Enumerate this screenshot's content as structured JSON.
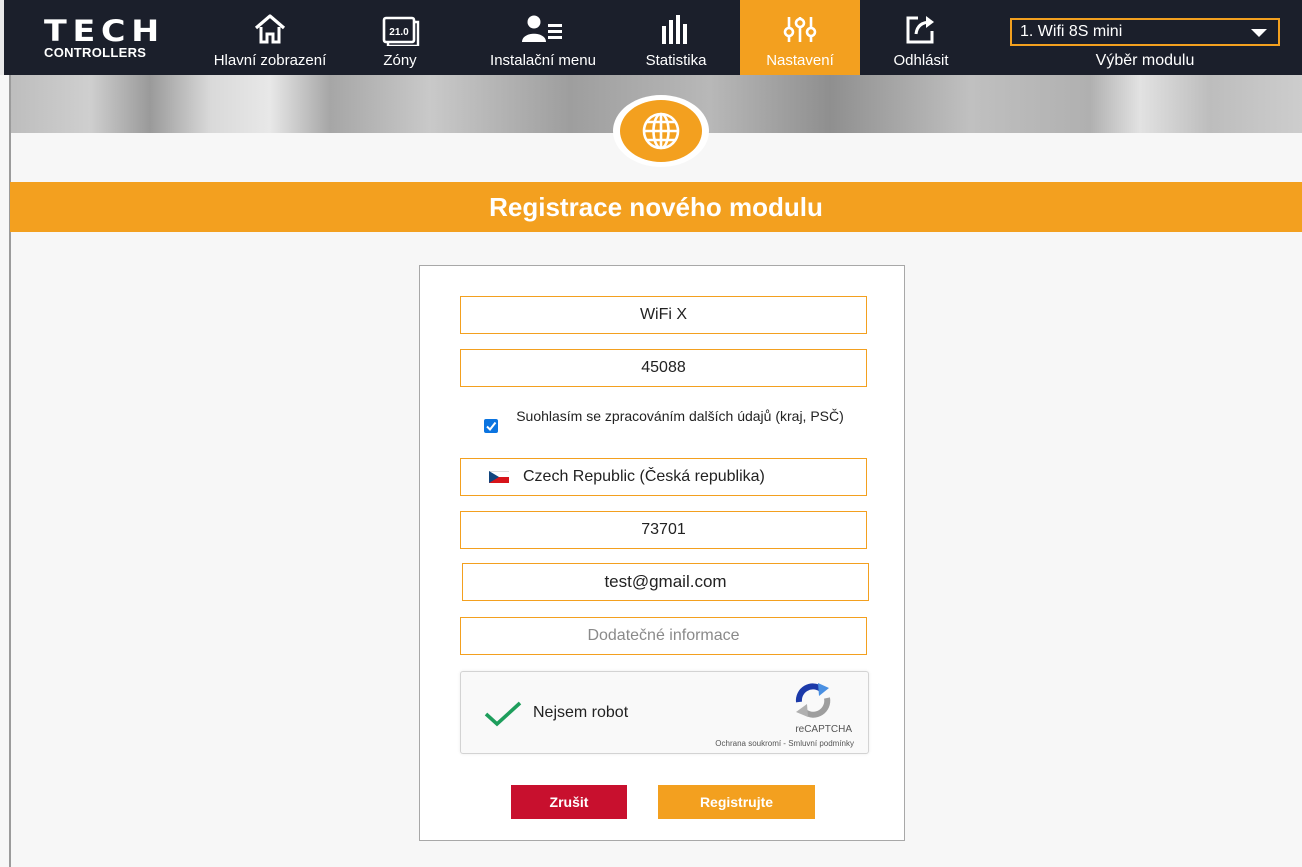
{
  "logo": {
    "line1": "TECH",
    "line2": "CONTROLLERS"
  },
  "nav": {
    "items": [
      {
        "label": "Hlavní zobrazení",
        "icon": "home-icon"
      },
      {
        "label": "Zóny",
        "icon": "thermostat-display-icon",
        "badge": "21.0"
      },
      {
        "label": "Instalační menu",
        "icon": "user-list-icon"
      },
      {
        "label": "Statistika",
        "icon": "bar-chart-icon"
      },
      {
        "label": "Nastavení",
        "icon": "sliders-icon",
        "active": true
      },
      {
        "label": "Odhlásit",
        "icon": "logout-icon"
      }
    ]
  },
  "module_select": {
    "value": "1. Wifi 8S mini",
    "label": "Výběr modulu"
  },
  "page": {
    "title": "Registrace nového modulu",
    "header_icon": "globe-icon"
  },
  "form": {
    "name_value": "WiFi X",
    "code_value": "45088",
    "consent": {
      "checked": true,
      "text": "Suohlasím se zpracováním dalších údajů (kraj, PSČ)"
    },
    "country_value": "Czech Republic (Česká republika)",
    "zip_value": "73701",
    "email_value": "test@gmail.com",
    "info_placeholder": "Dodatečné informace"
  },
  "recaptcha": {
    "label": "Nejsem robot",
    "brand": "reCAPTCHA",
    "links": "Ochrana soukromí - Smluvní podmínky",
    "checked": true
  },
  "buttons": {
    "cancel": "Zrušit",
    "register": "Registrujte"
  },
  "colors": {
    "accent": "#f3a01f",
    "nav_bg": "#1b1f2b",
    "cancel": "#c8102e",
    "check": "#0b74e0",
    "recaptcha_check": "#1e9e5c"
  }
}
